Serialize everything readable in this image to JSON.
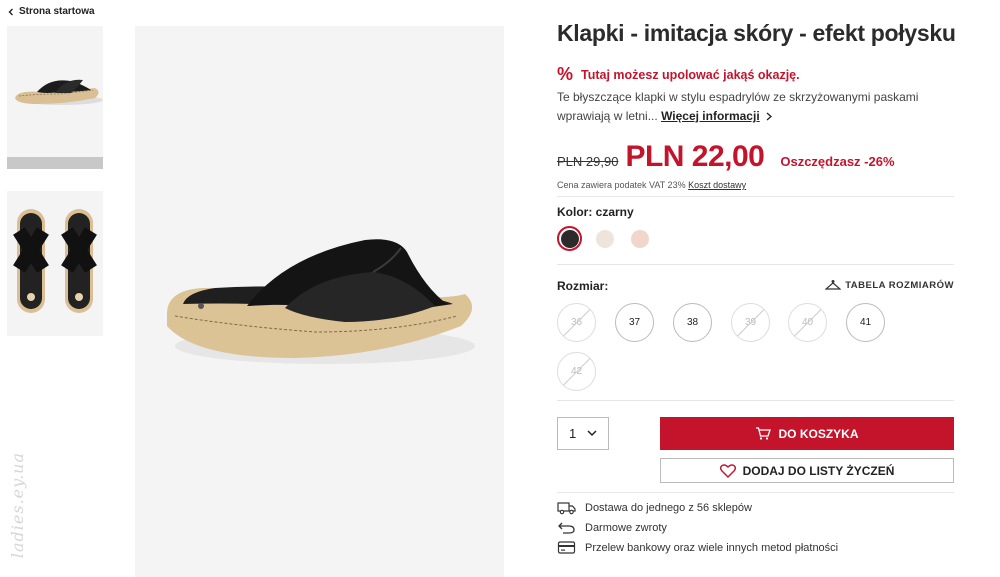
{
  "breadcrumb": {
    "back_label": "Strona startowa"
  },
  "watermark": "ladies.ey.ua",
  "product": {
    "title": "Klapki - imitacja skóry - efekt połysku",
    "promo_icon": "%",
    "promo_text": "Tutaj możesz upolować jakąś okazję.",
    "description": "Te błyszczące klapki w stylu espadrylów ze skrzyżowanymi paskami wprawiają w letni...",
    "more_info": "Więcej informacji",
    "old_price": "PLN 29,90",
    "new_price": "PLN 22,00",
    "savings": "Oszczędzasz -26%",
    "vat_text": "Cena zawiera podatek VAT 23%",
    "shipping_link": "Koszt dostawy"
  },
  "colors": {
    "label": "Kolor: czarny",
    "swatches": [
      {
        "name": "czarny",
        "hex": "#2b2b2b",
        "selected": true
      },
      {
        "name": "beżowy",
        "hex": "#efe4dc",
        "selected": false
      },
      {
        "name": "różowy",
        "hex": "#f1d6cc",
        "selected": false
      }
    ]
  },
  "sizes": {
    "label": "Rozmiar:",
    "table_label": "TABELA ROZMIARÓW",
    "items": [
      {
        "size": "36",
        "available": false
      },
      {
        "size": "37",
        "available": true
      },
      {
        "size": "38",
        "available": true
      },
      {
        "size": "39",
        "available": false
      },
      {
        "size": "40",
        "available": false
      },
      {
        "size": "41",
        "available": true
      },
      {
        "size": "42",
        "available": false
      }
    ]
  },
  "cart": {
    "quantity": "1",
    "add_to_cart": "DO KOSZYKA",
    "add_to_wishlist": "DODAJ DO LISTY ŻYCZEŃ"
  },
  "features": [
    {
      "icon": "truck-icon",
      "text": "Dostawa do jednego z 56 sklepów"
    },
    {
      "icon": "return-icon",
      "text": "Darmowe zwroty"
    },
    {
      "icon": "card-icon",
      "text": "Przelew bankowy oraz wiele innych metod płatności"
    }
  ],
  "colors_theme": {
    "accent": "#c4142c",
    "text": "#222222"
  }
}
